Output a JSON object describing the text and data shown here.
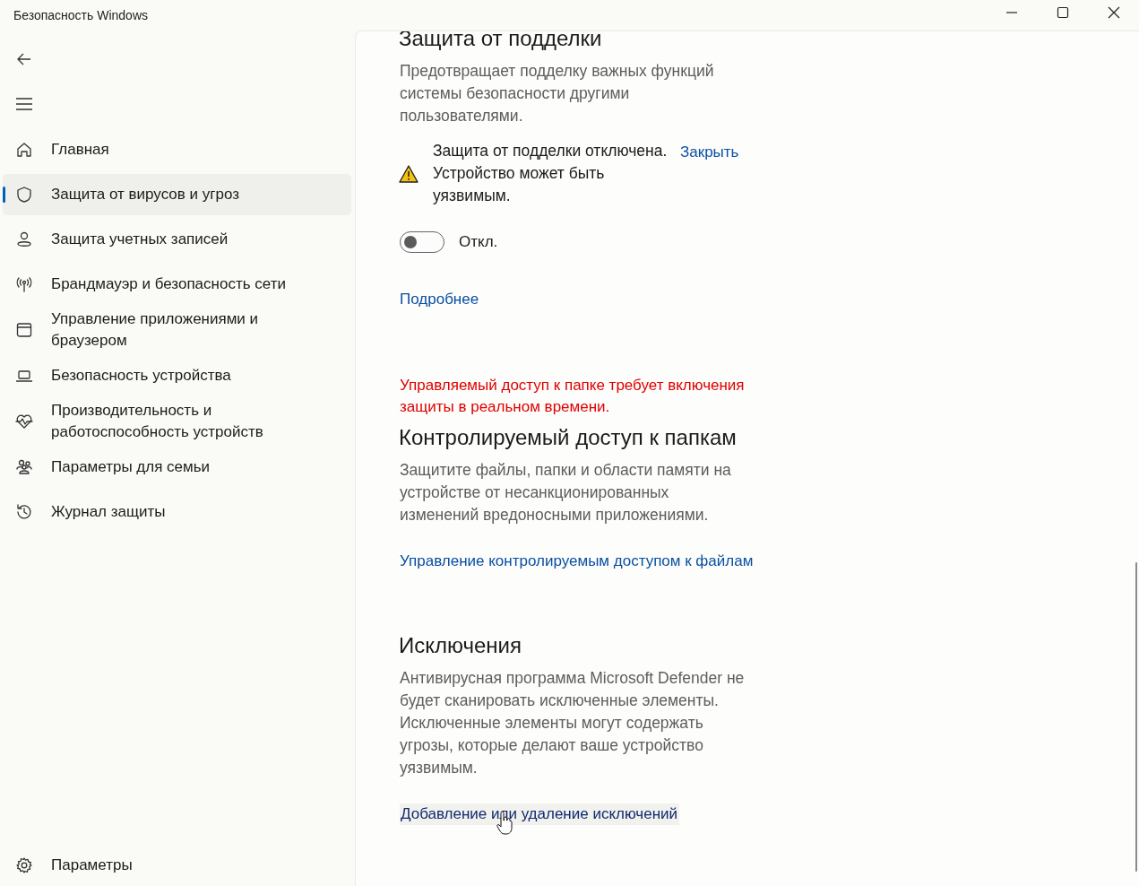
{
  "window": {
    "title": "Безопасность Windows"
  },
  "sidebar": {
    "items": [
      {
        "label": "Главная",
        "selected": false
      },
      {
        "label": "Защита от вирусов и угроз",
        "selected": true
      },
      {
        "label": "Защита учетных записей",
        "selected": false
      },
      {
        "label": "Брандмауэр и безопасность сети",
        "selected": false
      },
      {
        "label": "Управление приложениями и браузером",
        "selected": false
      },
      {
        "label": "Безопасность устройства",
        "selected": false
      },
      {
        "label": "Производительность и работоспособность устройств",
        "selected": false
      },
      {
        "label": "Параметры для семьи",
        "selected": false
      },
      {
        "label": "Журнал защиты",
        "selected": false
      }
    ],
    "settings": {
      "label": "Параметры",
      "selected": false
    }
  },
  "content": [
    {
      "kind": "heading",
      "text": "Защита от подделки"
    },
    {
      "kind": "text",
      "text": "Предотвращает подделку важных функций системы безопасности другими пользователями."
    },
    {
      "kind": "warning",
      "text": "Защита от подделки отключена. Устройство может быть уязвимым.",
      "action": "Закрыть"
    },
    {
      "kind": "toggle",
      "on": false,
      "label": "Откл."
    },
    {
      "kind": "link",
      "text": "Подробнее",
      "hovered": false
    },
    {
      "kind": "error",
      "text": "Управляемый доступ к папке требует включения защиты в реальном времени."
    },
    {
      "kind": "heading",
      "text": "Контролируемый доступ к папкам"
    },
    {
      "kind": "text",
      "text": "Защитите файлы, папки и области памяти на устройстве от несанкционированных изменений вредоносными приложениями."
    },
    {
      "kind": "link",
      "text": "Управление контролируемым доступом к файлам",
      "hovered": false
    },
    {
      "kind": "heading",
      "text": "Исключения"
    },
    {
      "kind": "text",
      "text": "Антивирусная программа Microsoft Defender не будет сканировать исключенные элементы. Исключенные элементы могут содержать угрозы, которые делают ваше устройство уязвимым."
    },
    {
      "kind": "link",
      "text": "Добавление или удаление исключений",
      "hovered": true
    }
  ]
}
